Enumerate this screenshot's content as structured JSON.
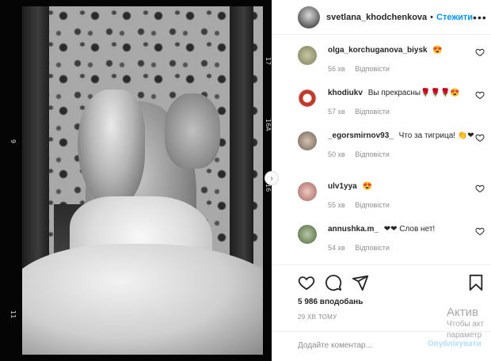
{
  "photo": {
    "film_numbers": [
      "17",
      "9",
      "16A",
      "16",
      "11"
    ]
  },
  "post": {
    "username": "svetlana_khodchenkova",
    "separator": "•",
    "follow_label": "Стежити",
    "more_label": "•••"
  },
  "comments": [
    {
      "user": "olga_korchuganova_biysk",
      "text": "😍",
      "time": "56 хв",
      "reply": "Відповісти",
      "avatar_color": "#9aa07a"
    },
    {
      "user": "khodiukv",
      "text": "Вы прекрасны🌹🌹🌹😍",
      "time": "57 хв",
      "reply": "Відповісти",
      "avatar_color": "#c0392b"
    },
    {
      "user": "_egorsmirnov93_",
      "text": "Что за тигрица! 👏❤",
      "time": "50 хв",
      "reply": "Відповісти",
      "avatar_color": "#8a7f75"
    },
    {
      "user": "ulv1yya",
      "text": "😍",
      "time": "55 хв",
      "reply": "Відповісти",
      "avatar_color": "#c98b8b"
    },
    {
      "user": "annushka.m_",
      "text": "❤❤ Слов нет!",
      "time": "54 хв",
      "reply": "Відповісти",
      "avatar_color": "#5f7a4e"
    }
  ],
  "actions": {
    "likes": "5 986 вподобань",
    "time_ago": "29 ХВ ТОМУ"
  },
  "add_comment": {
    "placeholder": "Додайте коментар...",
    "publish_label": "Опублікувати"
  },
  "watermark": {
    "title": "Актив",
    "line1": "Чтобы акт",
    "line2": "параметр"
  }
}
